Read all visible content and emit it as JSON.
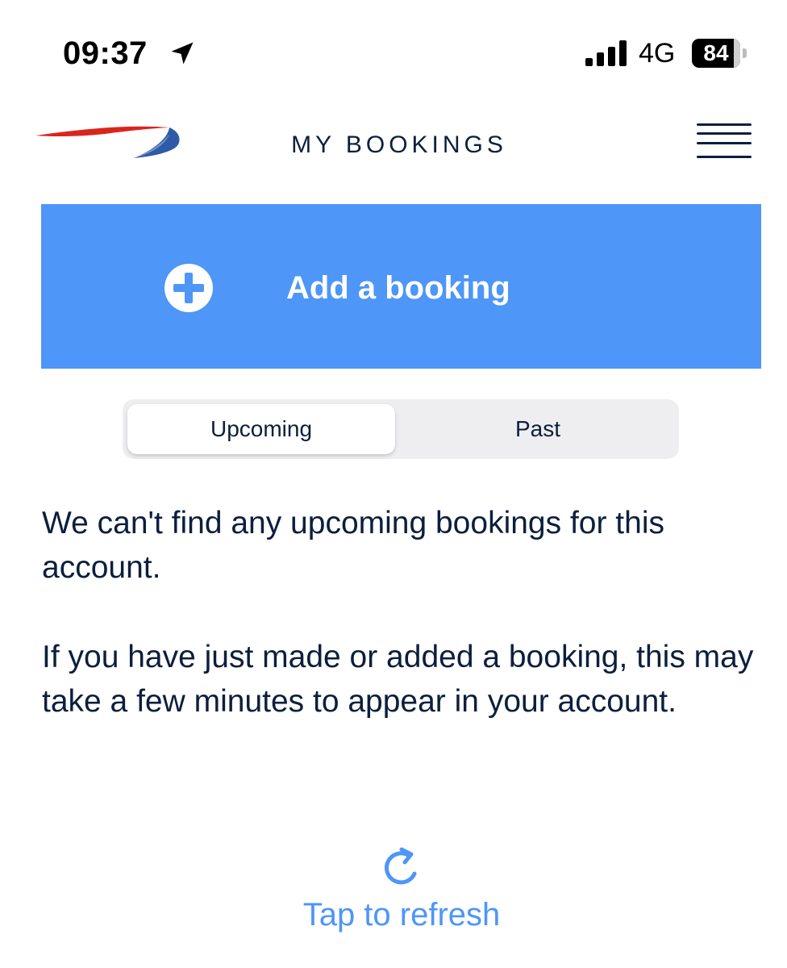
{
  "status_bar": {
    "time": "09:37",
    "network": "4G",
    "battery_level": "84",
    "location_icon": "location-arrow-icon",
    "signal_icon": "cellular-signal-icon"
  },
  "header": {
    "title": "MY BOOKINGS",
    "logo_icon": "speedmarque-logo",
    "menu_icon": "hamburger-menu-icon"
  },
  "add_booking": {
    "label": "Add a booking",
    "icon": "plus-circle-icon"
  },
  "tabs": [
    {
      "label": "Upcoming",
      "selected": true
    },
    {
      "label": "Past",
      "selected": false
    }
  ],
  "messages": {
    "empty": "We can't find any upcoming bookings for this account.",
    "info": "If you have just made or added a booking, this may take a few minutes to appear in your account."
  },
  "refresh": {
    "label": "Tap to refresh",
    "icon": "refresh-icon"
  },
  "colors": {
    "accent_blue": "#4e96f7",
    "navy_text": "#0b1f3d",
    "logo_red": "#d9261c",
    "logo_blue": "#2e5aa7",
    "segment_bg": "#eeeef0"
  }
}
